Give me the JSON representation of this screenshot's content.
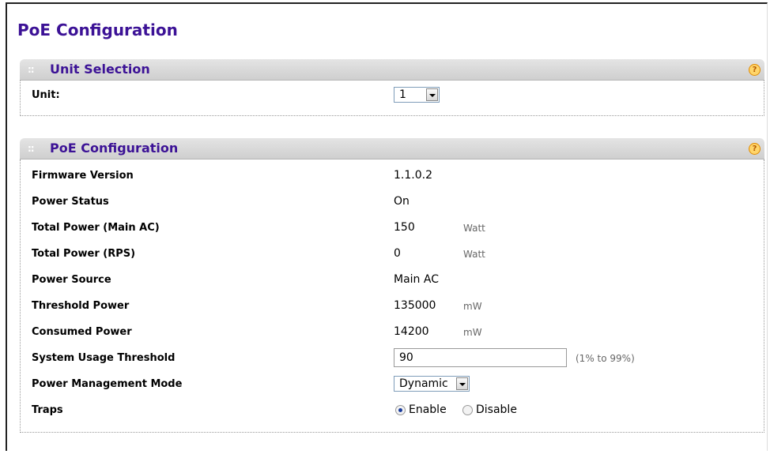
{
  "page": {
    "title": "PoE Configuration"
  },
  "unit_selection": {
    "title": "Unit Selection",
    "unit_label": "Unit:",
    "unit_value": "1"
  },
  "poe_config": {
    "title": "PoE Configuration",
    "fields": {
      "firmware_version": {
        "label": "Firmware Version",
        "value": "1.1.0.2"
      },
      "power_status": {
        "label": "Power Status",
        "value": "On"
      },
      "total_power_main": {
        "label": "Total Power (Main AC)",
        "value": "150",
        "unit": "Watt"
      },
      "total_power_rps": {
        "label": "Total Power (RPS)",
        "value": "0",
        "unit": "Watt"
      },
      "power_source": {
        "label": "Power Source",
        "value": "Main AC"
      },
      "threshold_power": {
        "label": "Threshold Power",
        "value": "135000",
        "unit": "mW"
      },
      "consumed_power": {
        "label": "Consumed Power",
        "value": "14200",
        "unit": "mW"
      },
      "system_usage_threshold": {
        "label": "System Usage Threshold",
        "value": "90",
        "range": "(1% to 99%)"
      },
      "power_management_mode": {
        "label": "Power Management Mode",
        "value": "Dynamic"
      },
      "traps": {
        "label": "Traps",
        "options": [
          "Enable",
          "Disable"
        ],
        "selected": "Enable"
      }
    }
  },
  "colors": {
    "title": "#3c1296",
    "help_icon": "#ffd56a",
    "header_bg": "#d9d9d9"
  },
  "icons": {
    "help": "help-icon",
    "grip": "grip-icon",
    "dropdown": "chevron-down-icon"
  }
}
